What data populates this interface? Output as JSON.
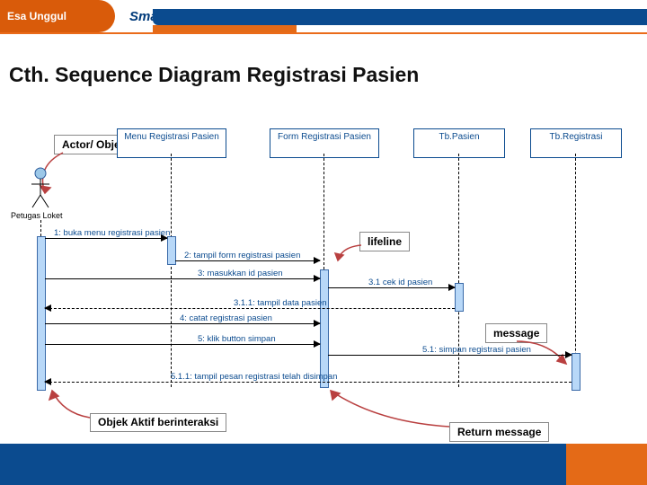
{
  "header": {
    "university": "Esa Unggul",
    "slogan": "Smart, Creative and Entrepreneurial"
  },
  "title": "Cth. Sequence Diagram Registrasi Pasien",
  "labels": {
    "actor_object": "Actor/ Object",
    "lifeline": "lifeline",
    "message": "message",
    "objek_aktif": "Objek Aktif berinteraksi",
    "return_message": "Return message"
  },
  "actor": "Petugas Loket",
  "participants": {
    "p1": "Menu Registrasi Pasien",
    "p2": "Form Registrasi Pasien",
    "p3": "Tb.Pasien",
    "p4": "Tb.Registrasi"
  },
  "messages": {
    "m1": "1: buka menu registrasi pasien",
    "m2": "2: tampil form registrasi pasien",
    "m3": "3: masukkan id pasien",
    "m3_1": "3.1 cek id pasien",
    "m3_1_1": "3.1.1: tampil data pasien",
    "m4": "4: catat registrasi pasien",
    "m5": "5: klik button simpan",
    "m5_1": "5.1: simpan registrasi pasien",
    "m5_1_1": "5.1.1: tampil pesan registrasi telah disimpan"
  }
}
